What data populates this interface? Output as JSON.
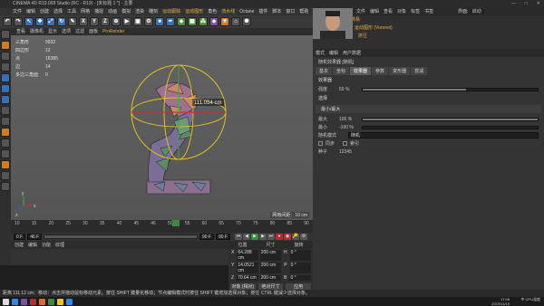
{
  "window": {
    "title": "CINEMA 4D R19.068 Studio (RC - R19) - [未标题 1 *] - 主要",
    "controls": [
      "—",
      "□",
      "✕"
    ]
  },
  "menubar": {
    "items": [
      "文件",
      "编辑",
      "创建",
      "选择",
      "工具",
      "网格",
      "捕捉",
      "动画",
      "模拟",
      "渲染",
      "雕刻",
      "运动跟踪",
      "运动图形",
      "角色",
      "流水线",
      "Octane",
      "插件",
      "脚本",
      "窗口",
      "帮助"
    ],
    "highlight": [
      "运动跟踪",
      "运动图形",
      "流水线"
    ],
    "layout_label": "界面:",
    "layout_value": "启动"
  },
  "toolbar": {
    "icons": [
      {
        "name": "undo-icon",
        "g": "↶",
        "c": "gray"
      },
      {
        "name": "redo-icon",
        "g": "↷",
        "c": "gray"
      },
      {
        "name": "live-select-icon",
        "g": "↖",
        "c": "blue"
      },
      {
        "name": "move-icon",
        "g": "✥",
        "c": "blue"
      },
      {
        "name": "scale-icon",
        "g": "⤢",
        "c": "blue"
      },
      {
        "name": "rotate-icon",
        "g": "↻",
        "c": "blue"
      },
      {
        "name": "last-tool-icon",
        "g": "✎",
        "c": "gray"
      },
      {
        "name": "x-axis-icon",
        "g": "X",
        "c": "gray"
      },
      {
        "name": "y-axis-icon",
        "g": "Y",
        "c": "gray"
      },
      {
        "name": "z-axis-icon",
        "g": "Z",
        "c": "gray"
      },
      {
        "name": "coord-system-icon",
        "g": "⊕",
        "c": "gray"
      },
      {
        "name": "render-view-icon",
        "g": "▶",
        "c": "gray"
      },
      {
        "name": "render-picture-viewer-icon",
        "g": "▣",
        "c": "gray"
      },
      {
        "name": "render-settings-icon",
        "g": "⚙",
        "c": "gray"
      },
      {
        "name": "cube-icon",
        "g": "■",
        "c": "blue"
      },
      {
        "name": "pen-icon",
        "g": "✒",
        "c": "blue"
      },
      {
        "name": "subdivision-icon",
        "g": "◆",
        "c": "green"
      },
      {
        "name": "array-icon",
        "g": "▦",
        "c": "green"
      },
      {
        "name": "mograph-cloner-icon",
        "g": "⁂",
        "c": "green"
      },
      {
        "name": "deformer-icon",
        "g": "◈",
        "c": "purple"
      },
      {
        "name": "scene-icon",
        "g": "☀",
        "c": "orange"
      },
      {
        "name": "camera-icon",
        "g": "⌂",
        "c": "gray"
      },
      {
        "name": "light-icon",
        "g": "✺",
        "c": "gray"
      }
    ]
  },
  "lefttools": [
    {
      "name": "make-editable-icon",
      "c": "gray"
    },
    {
      "name": "model-mode-icon",
      "c": "orange"
    },
    {
      "name": "texture-mode-icon",
      "c": "gray"
    },
    {
      "name": "workplane-icon",
      "c": "gray"
    },
    {
      "name": "points-mode-icon",
      "c": "blue"
    },
    {
      "name": "edges-mode-icon",
      "c": "blue"
    },
    {
      "name": "polygons-mode-icon",
      "c": "blue"
    },
    {
      "name": "axis-mode-icon",
      "c": "gray"
    },
    {
      "name": "tweak-icon",
      "c": "gray"
    },
    {
      "name": "snap-icon",
      "c": "orange"
    },
    {
      "name": "quantize-icon",
      "c": "gray"
    },
    {
      "name": "lock-workplane-icon",
      "c": "gray"
    },
    {
      "name": "sculpt-icon",
      "c": "orange"
    },
    {
      "name": "solo-icon",
      "c": "gray"
    },
    {
      "name": "symmetry-icon",
      "c": "gray"
    }
  ],
  "viewport": {
    "menu": [
      "查看",
      "摄像机",
      "显示",
      "选项",
      "过滤",
      "面板",
      "ProRender"
    ],
    "menu_highlight": "ProRender",
    "hud": [
      {
        "label": "三角形",
        "value": "9932"
      },
      {
        "label": "四边形",
        "value": "12"
      },
      {
        "label": "点",
        "value": "16385"
      },
      {
        "label": "边",
        "value": "14"
      },
      {
        "label": "多边三角面",
        "value": "0"
      }
    ],
    "tooltip": "111.054 cm",
    "grid_spacing": "网格间距：10 cm",
    "axis_labels": {
      "x": "x",
      "y": "y",
      "z": "z"
    }
  },
  "timeline": {
    "ticks": [
      "10",
      "15",
      "20",
      "25",
      "30",
      "35",
      "40",
      "45",
      "46",
      "50",
      "55",
      "60",
      "65",
      "70",
      "75",
      "80",
      "85",
      "90"
    ],
    "current_frame": "46 F",
    "start_frame": "0 F",
    "end_frame": "90 F",
    "end_frame_2": "90 F"
  },
  "materials": {
    "menu": [
      "创建",
      "编辑",
      "功能",
      "纹理"
    ]
  },
  "coordinates": {
    "headers": [
      "位置",
      "尺寸",
      "旋转"
    ],
    "rows": [
      {
        "axis": "X",
        "pos": "64.288 cm",
        "size": "200 cm",
        "rot_label": "H",
        "rot": "0 °"
      },
      {
        "axis": "Y",
        "pos": "14.0521 cm",
        "size": "200 cm",
        "rot_label": "P",
        "rot": "0 °"
      },
      {
        "axis": "Z",
        "pos": "70.64 cm",
        "size": "200 cm",
        "rot_label": "B",
        "rot": "0 °"
      }
    ],
    "mode": "对象 (相对)",
    "size_mode": "绝对尺寸",
    "apply": "应用"
  },
  "objects": {
    "menu": [
      "文件",
      "编辑",
      "查看",
      "对象",
      "标签",
      "书签"
    ],
    "rows": [
      "简易",
      "运动图形 (Voronoi)",
      "挤压"
    ]
  },
  "attributes": {
    "menu": [
      "模式",
      "编辑",
      "用户数据"
    ],
    "title": "随机效果器 [随机]",
    "tabs": [
      "基本",
      "坐标",
      "效果器",
      "参数",
      "变形器",
      "衰减"
    ],
    "active_tab": "效果器",
    "section1": "效果器",
    "strength_label": "强度",
    "strength_value": "59 %",
    "strength": 0.59,
    "section2": "选择",
    "sub": "最小/最大",
    "max_label": "最大",
    "max_value": "100 %",
    "max": 1.0,
    "min_label": "最小",
    "min_value": "-100 %",
    "min": 0.0,
    "random_mode_label": "随机模式",
    "random_mode_value": "随机",
    "sync_label": "同步",
    "index_label": "索引",
    "seed_label": "种子",
    "seed_value": "12345"
  },
  "statusbar": {
    "text": "距离 111.12 cm：移动：点击并拖动鼠标移动元素。按住 SHIFT 键量化移动；节点编辑模式时按住 SHIFT 键增加选择对象；按住 CTRL 键减少选择对象。"
  },
  "taskbar": {
    "icons": [
      "#2d89ef",
      "#f0c419",
      "#3c8a3c",
      "#e06c2a",
      "#b03030",
      "#7d4fa8",
      "#2d89ef",
      "#ddd"
    ],
    "time": "17:08",
    "date": "2019/11/19",
    "tray": "中 CPU温度"
  }
}
